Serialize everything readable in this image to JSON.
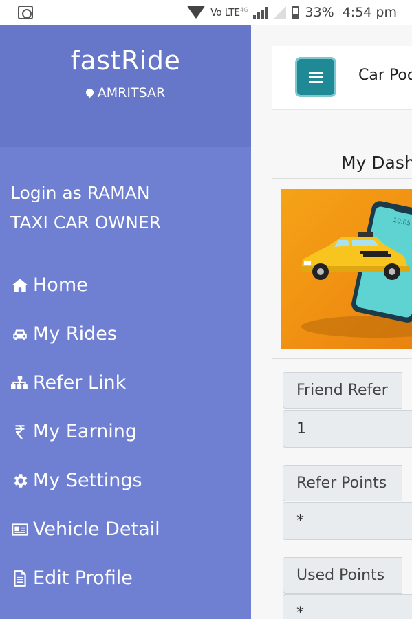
{
  "status_bar": {
    "network_label": "Vo LTE",
    "network_sup": "4G",
    "battery": "33%",
    "time": "4:54 pm"
  },
  "sidebar": {
    "brand": "fastRide",
    "city": "AMRITSAR",
    "login_line1": "Login as RAMAN",
    "login_line2": "TAXI CAR OWNER",
    "items": [
      {
        "label": "Home",
        "icon": "home-icon"
      },
      {
        "label": "My Rides",
        "icon": "car-icon"
      },
      {
        "label": "Refer Link",
        "icon": "sitemap-icon"
      },
      {
        "label": "My Earning",
        "icon": "rupee-icon"
      },
      {
        "label": "My Settings",
        "icon": "gear-icon"
      },
      {
        "label": "Vehicle Detail",
        "icon": "id-card-icon"
      },
      {
        "label": "Edit Profile",
        "icon": "document-icon"
      }
    ]
  },
  "main": {
    "header_title": "Car Pooling",
    "dashboard_title": "My Dashboard",
    "fields": [
      {
        "label": "Friend Refer",
        "value": "1"
      },
      {
        "label": "Refer Points",
        "value": "*"
      },
      {
        "label": "Used Points",
        "value": "*"
      }
    ]
  },
  "colors": {
    "sidebar_bg": "#6f80d2",
    "brand_bg": "#6676c9",
    "menu_button": "#1f8a96",
    "banner_orange": "#f5a316"
  }
}
